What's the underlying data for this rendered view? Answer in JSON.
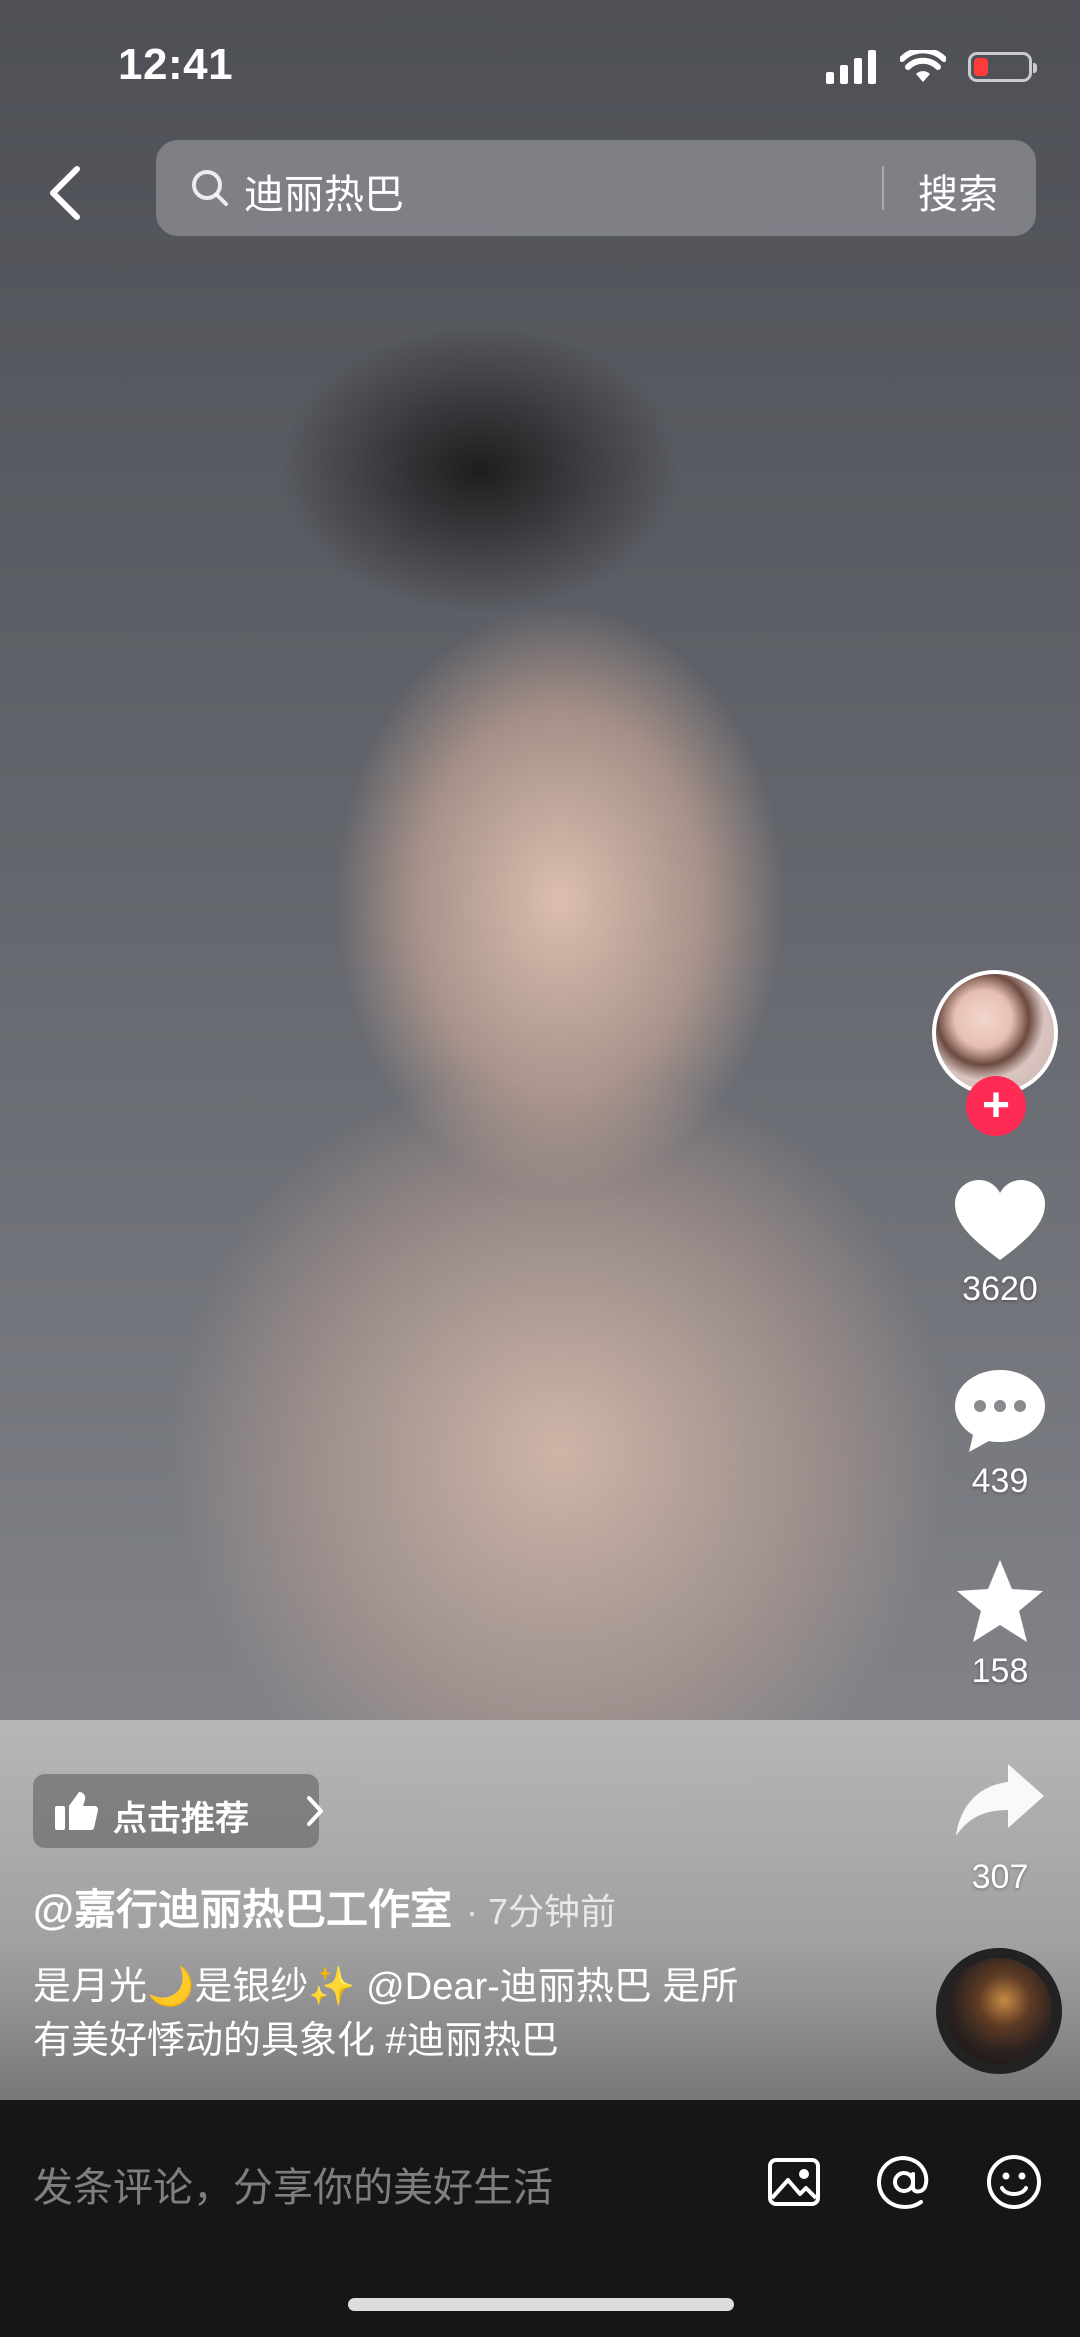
{
  "status_bar": {
    "time": "12:41"
  },
  "search": {
    "query": "迪丽热巴",
    "button_label": "搜索"
  },
  "engagement": {
    "likes": "3620",
    "comments": "439",
    "favorites": "158",
    "shares": "307"
  },
  "post": {
    "recommend_label": "点击推荐",
    "author": "@嘉行迪丽热巴工作室",
    "time_ago": "· 7分钟前",
    "caption_line1": "是月光🌙是银纱✨ @Dear-迪丽热巴 是所",
    "caption_line2": "有美好悸动的具象化 #迪丽热巴"
  },
  "comment_bar": {
    "placeholder": "发条评论，分享你的美好生活"
  },
  "colors": {
    "accent": "#fe2c55",
    "battery_low": "#ff3b3b"
  },
  "icons": [
    "back-icon",
    "search-icon",
    "heart-icon",
    "comment-icon",
    "star-icon",
    "share-icon",
    "thumbs-up-icon",
    "image-icon",
    "at-icon",
    "emoji-icon"
  ]
}
